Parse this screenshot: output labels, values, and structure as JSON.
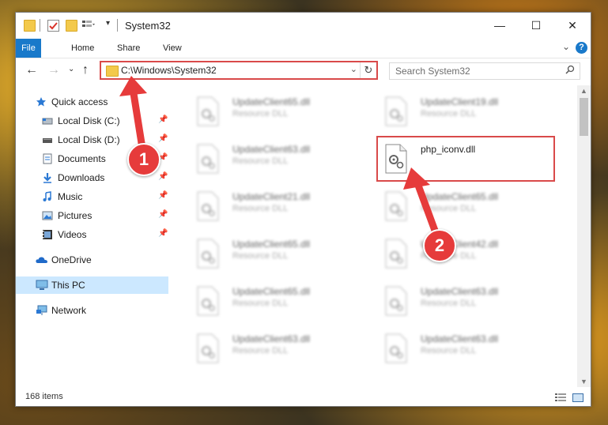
{
  "window": {
    "title": "System32"
  },
  "ribbon": {
    "tabs": [
      "File",
      "Home",
      "Share",
      "View"
    ],
    "help": "?"
  },
  "address": {
    "path": "C:\\Windows\\System32"
  },
  "search": {
    "placeholder": "Search System32"
  },
  "nav": {
    "items": [
      {
        "label": "Quick access",
        "icon": "star-icon"
      },
      {
        "label": "Local Disk (C:)",
        "icon": "drive-icon"
      },
      {
        "label": "Local Disk (D:)",
        "icon": "drive-icon"
      },
      {
        "label": "Documents",
        "icon": "documents-icon"
      },
      {
        "label": "Downloads",
        "icon": "download-icon"
      },
      {
        "label": "Music",
        "icon": "music-icon"
      },
      {
        "label": "Pictures",
        "icon": "pictures-icon"
      },
      {
        "label": "Videos",
        "icon": "videos-icon"
      },
      {
        "label": "OneDrive",
        "icon": "cloud-icon"
      },
      {
        "label": "This PC",
        "icon": "computer-icon"
      },
      {
        "label": "Network",
        "icon": "network-icon"
      }
    ]
  },
  "files": {
    "left": [
      {
        "name": "UpdateClient65.dll",
        "type": "Resource DLL"
      },
      {
        "name": "UpdateClient63.dll",
        "type": "Resource DLL"
      },
      {
        "name": "UpdateClient21.dll",
        "type": "Resource DLL"
      },
      {
        "name": "UpdateClient65.dll",
        "type": "Resource DLL"
      },
      {
        "name": "UpdateClient65.dll",
        "type": "Resource DLL"
      },
      {
        "name": "UpdateClient63.dll",
        "type": "Resource DLL"
      }
    ],
    "right": [
      {
        "name": "UpdateClient19.dll",
        "type": "Resource DLL"
      },
      {
        "name": "php_iconv.dll",
        "type": ""
      },
      {
        "name": "UpdateClient65.dll",
        "type": "Resource DLL"
      },
      {
        "name": "UpdateClient42.dll",
        "type": "Resource DLL"
      },
      {
        "name": "UpdateClient63.dll",
        "type": "Resource DLL"
      },
      {
        "name": "UpdateClient63.dll",
        "type": "Resource DLL"
      }
    ]
  },
  "status": {
    "count": "168 items"
  },
  "annotations": {
    "step1": "1",
    "step2": "2"
  },
  "colors": {
    "accent": "#1979ca",
    "annotation": "#e63b3b",
    "selected": "#cce8ff"
  }
}
